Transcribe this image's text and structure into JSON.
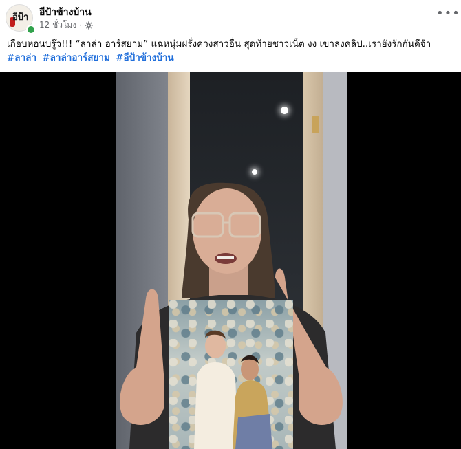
{
  "post": {
    "page_name": "อีป้าข้างบ้าน",
    "time": "12 ชั่วโมง",
    "separator": "·",
    "avatar_text": "อีป้า",
    "more_label": "•••",
    "caption": "เกือบหอนบรู๊ว!!! “ลาล่า อาร์สยาม” แฉหนุ่มฝรั่งควงสาวอื่น สุดท้ายชาวเน็ต งง เขาลงคลิป..เรายังรักกันดีจ้า",
    "hashtags": [
      "#ลาล่า",
      "#ลาล่าอาร์สยาม",
      "#อีป้าข้างบ้าน"
    ]
  },
  "colors": {
    "link": "#216fdb",
    "secondary_text": "#65676b",
    "online": "#31a24c",
    "media_bg": "#000000"
  },
  "icons": {
    "privacy": "gear-icon",
    "more": "more-horizontal-icon"
  }
}
